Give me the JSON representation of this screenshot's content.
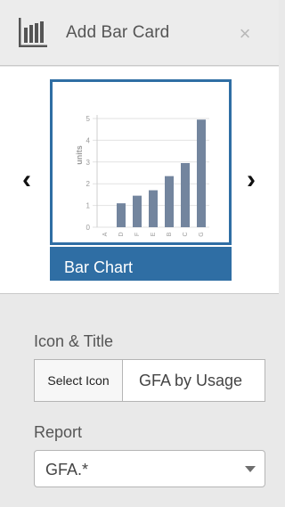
{
  "header": {
    "title": "Add Bar Card",
    "icon": "bar-chart-icon",
    "close_label": "×"
  },
  "carousel": {
    "prev_label": "‹",
    "next_label": "›",
    "selected": {
      "label": "Bar Chart",
      "accent_color": "#2f6ea4"
    },
    "preview": {
      "bar_color": "#73859e",
      "chart_data": {
        "type": "bar",
        "categories": [
          "A",
          "D",
          "F",
          "E",
          "B",
          "C",
          "G"
        ],
        "values": [
          0,
          1.1,
          1.45,
          1.7,
          2.35,
          2.95,
          4.95
        ],
        "ylabel": "units",
        "yticks": [
          0,
          1,
          2,
          3,
          4,
          5
        ],
        "ylim": [
          0,
          5
        ],
        "grid": true
      }
    }
  },
  "form": {
    "icon_title_label": "Icon & Title",
    "select_icon_label": "Select Icon",
    "title_value": "GFA by Usage",
    "report_label": "Report",
    "report_value": "GFA.*"
  }
}
